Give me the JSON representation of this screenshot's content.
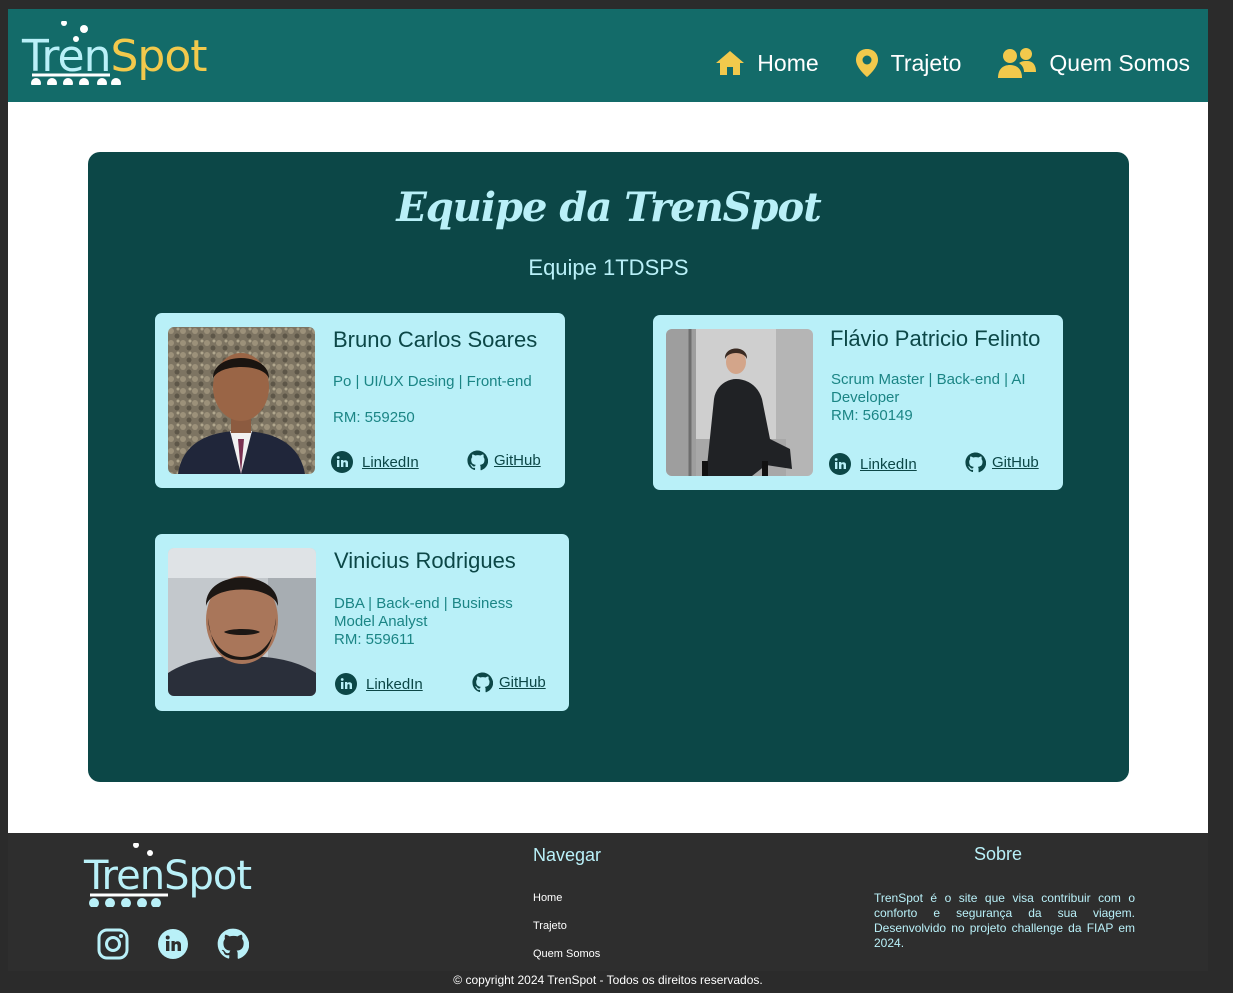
{
  "header": {
    "logo_tren": "Tren",
    "logo_spot": "Spot",
    "nav": [
      {
        "label": "Home",
        "icon": "home-icon"
      },
      {
        "label": "Trajeto",
        "icon": "map-pin-icon"
      },
      {
        "label": "Quem Somos",
        "icon": "users-icon"
      }
    ]
  },
  "team": {
    "title": "Equipe da TrenSpot",
    "subtitle": "Equipe 1TDSPS",
    "members": [
      {
        "name": "Bruno Carlos Soares",
        "role": "Po | UI/UX Desing | Front-end",
        "rm": "RM: 559250",
        "linkedin": "LinkedIn",
        "github": "GitHub"
      },
      {
        "name": "Flávio Patricio Felinto",
        "role": "Scrum Master | Back-end | AI Developer",
        "rm": "RM: 560149",
        "linkedin": "LinkedIn",
        "github": "GitHub"
      },
      {
        "name": "Vinicius Rodrigues",
        "role": "DBA | Back-end | Business Model Analyst",
        "rm": "RM: 559611",
        "linkedin": "LinkedIn",
        "github": "GitHub"
      }
    ]
  },
  "footer": {
    "logo_text": "TrenSpot",
    "social": [
      "instagram-icon",
      "linkedin-icon",
      "github-icon"
    ],
    "nav_title": "Navegar",
    "nav_links": [
      "Home",
      "Trajeto",
      "Quem Somos"
    ],
    "about_title": "Sobre",
    "about_text": "TrenSpot é o site que visa contribuir com o conforto e segurança da sua viagem. Desenvolvido no projeto challenge da FIAP em 2024.",
    "copyright": "© copyright 2024 TrenSpot - Todos os direitos reservados."
  },
  "colors": {
    "header_bg": "#136b69",
    "panel_bg": "#0c4747",
    "card_bg": "#b9f0f8",
    "accent_yellow": "#f2c94c",
    "footer_bg": "#2e2e2e"
  }
}
